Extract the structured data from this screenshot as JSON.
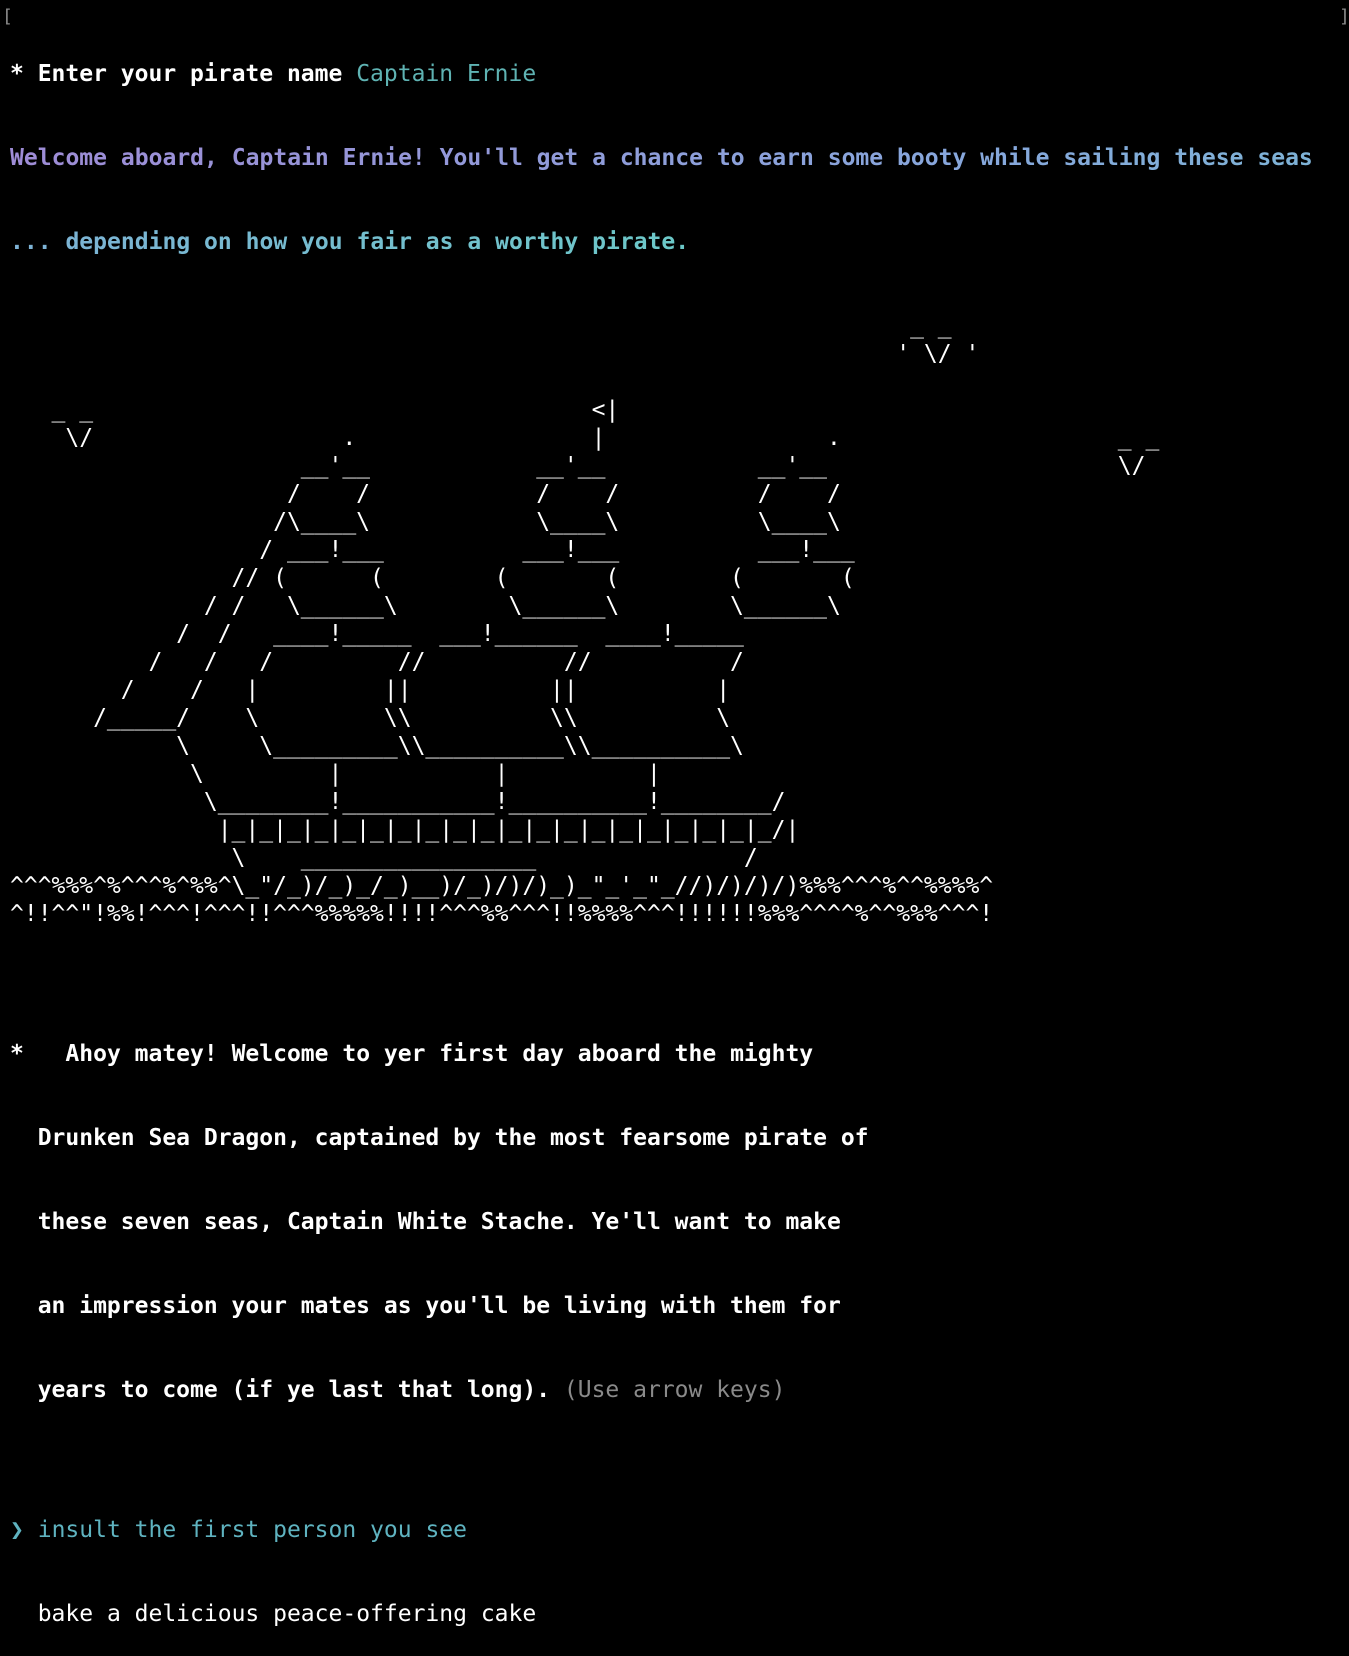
{
  "prompt": {
    "marker": "* ",
    "question": "Enter your pirate name",
    "answer": "Captain Ernie"
  },
  "welcome": {
    "line1": "Welcome aboard, Captain Ernie! You'll get a chance to earn some booty while sailing these seas",
    "line2": "... depending on how you fair as a worthy pirate.",
    "gradient": [
      "#9e8cd6",
      "#86a8dc",
      "#6cc8c8"
    ]
  },
  "ship_art": [
    "                                                                 _ _",
    "                                                                ' \\/ '",
    "",
    "   _ _                                    <|",
    "    \\/                  .                 |                .                    _ _",
    "                     __'__            __'__           __'__                     \\/",
    "                    /    /            /    /          /    /",
    "                   /\\____\\            \\____\\          \\____\\",
    "                  / ___!___          ___!___          ___!___",
    "                // (      (        (       (        (       (",
    "              / /   \\______\\        \\______\\        \\______\\",
    "            /  /   ____!_____  ___!______  ____!_____",
    "          /   /   /         //          //          /",
    "        /    /   |         ||          ||          |",
    "      /_____/    \\         \\\\          \\\\          \\",
    "            \\     \\_________\\\\__________\\\\__________\\",
    "             \\         |           |          |",
    "              \\________!___________!__________!________/",
    "               |_|_|_|_|_|_|_|_|_|_|_|_|_|_|_|_|_|_|_|_/|",
    "                \\    _________________               /",
    "^^^%%%^%^^^%^%%^\\_\"/_)/_)_/_)__)/_)/)/)_)_\"_'_\"_//)/)/)/)%%%^^^%^^%%%%^",
    "^!!^^\"!%%!^^^!^^^!!^^^%%%%%!!!!^^^%%^^^!!%%%%^^^!!!!!!%%%^^^^%^^%%%^^^!"
  ],
  "question2": {
    "marker": "*",
    "lines": [
      "   Ahoy matey! Welcome to yer first day aboard the mighty",
      "  Drunken Sea Dragon, captained by the most fearsome pirate of",
      "  these seven seas, Captain White Stache. Ye'll want to make",
      "  an impression your mates as you'll be living with them for",
      "  years to come (if ye last that long). "
    ],
    "hint": "(Use arrow keys)"
  },
  "options": {
    "pointer": "❯",
    "items": [
      "insult the first person you see",
      "bake a delicious peace-offering cake"
    ],
    "selected_index": 0
  },
  "colors": {
    "background": "#000000",
    "text": "#ffffff",
    "answer": "#5fb3b3",
    "selected": "#5fb3c0",
    "hint": "#8a8a8a"
  }
}
